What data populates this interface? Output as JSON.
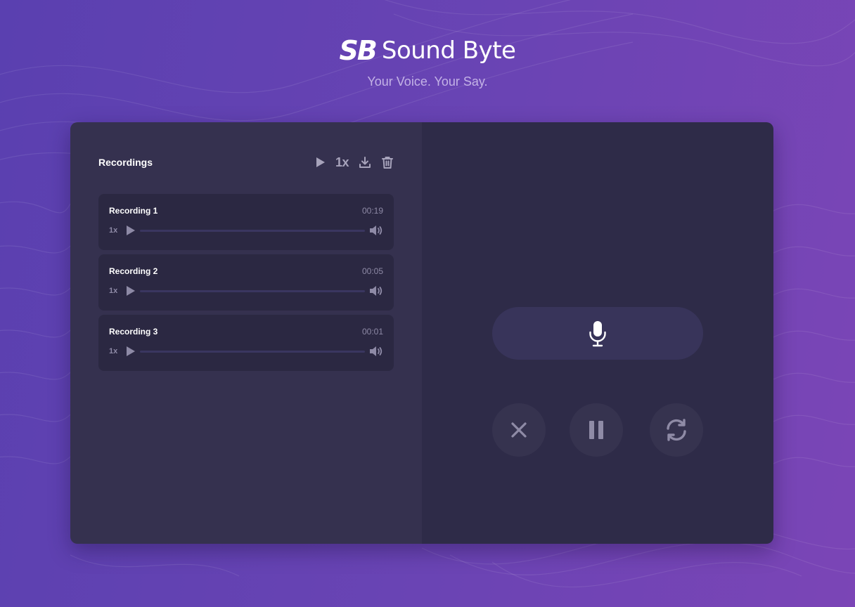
{
  "brand": {
    "mark": "SB",
    "name": "Sound Byte",
    "tagline": "Your Voice. Your Say."
  },
  "recordings_panel": {
    "title": "Recordings",
    "speed_label": "1x",
    "icons": [
      "play-icon",
      "download-icon",
      "trash-icon"
    ]
  },
  "recordings": [
    {
      "name": "Recording 1",
      "duration": "00:19",
      "speed": "1x"
    },
    {
      "name": "Recording 2",
      "duration": "00:05",
      "speed": "1x"
    },
    {
      "name": "Recording 3",
      "duration": "00:01",
      "speed": "1x"
    }
  ],
  "recorder": {
    "icons": {
      "record": "microphone-icon",
      "cancel": "close-icon",
      "pause": "pause-icon",
      "reset": "refresh-icon"
    }
  },
  "colors": {
    "bg_start": "#5a40b0",
    "bg_end": "#7b45b6",
    "left_panel": "#35314f",
    "right_panel": "#2e2b48",
    "item_bg": "#2b2842",
    "muted": "#8e8aa6"
  }
}
